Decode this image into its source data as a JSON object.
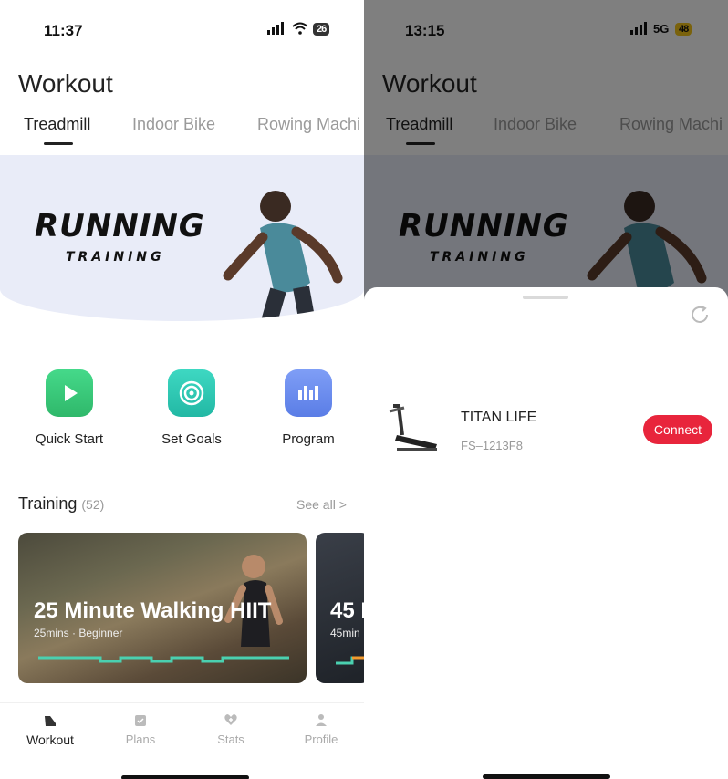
{
  "left": {
    "status": {
      "time": "11:37",
      "battery": "26"
    },
    "title": "Workout",
    "tabs": [
      {
        "label": "Treadmill",
        "active": true
      },
      {
        "label": "Indoor Bike",
        "active": false
      },
      {
        "label": "Rowing Machi",
        "active": false
      }
    ],
    "hero": {
      "line1": "RUNNING",
      "line2": "TRAINING"
    },
    "actions": [
      {
        "label": "Quick Start",
        "color": "#3ecf7a",
        "icon": "play-icon"
      },
      {
        "label": "Set Goals",
        "color": "#2ec9b4",
        "icon": "target-icon"
      },
      {
        "label": "Program",
        "color": "#6f8ff0",
        "icon": "program-icon"
      }
    ],
    "training": {
      "label": "Training",
      "count": "(52)",
      "see_all": "See all  >"
    },
    "cards": [
      {
        "title": "25 Minute Walking HIIT",
        "subtitle": "25mins · Beginner"
      },
      {
        "title": "45 I",
        "subtitle": "45min"
      }
    ],
    "nav": [
      {
        "label": "Workout",
        "icon": "shoe-icon",
        "active": true
      },
      {
        "label": "Plans",
        "icon": "calendar-icon",
        "active": false
      },
      {
        "label": "Stats",
        "icon": "heart-icon",
        "active": false
      },
      {
        "label": "Profile",
        "icon": "person-icon",
        "active": false
      }
    ]
  },
  "right": {
    "status": {
      "time": "13:15",
      "network": "5G",
      "battery": "48"
    },
    "title": "Workout",
    "tabs": [
      {
        "label": "Treadmill",
        "active": true
      },
      {
        "label": "Indoor Bike",
        "active": false
      },
      {
        "label": "Rowing Machi",
        "active": false
      }
    ],
    "hero": {
      "line1": "RUNNING",
      "line2": "TRAINING"
    },
    "device": {
      "name": "TITAN LIFE",
      "model": "FS–1213F8",
      "connect_label": "Connect"
    }
  },
  "colors": {
    "accent_red": "#e8253c",
    "hero_bg": "#e9ecf8",
    "battery_yellow": "#f5c518"
  }
}
